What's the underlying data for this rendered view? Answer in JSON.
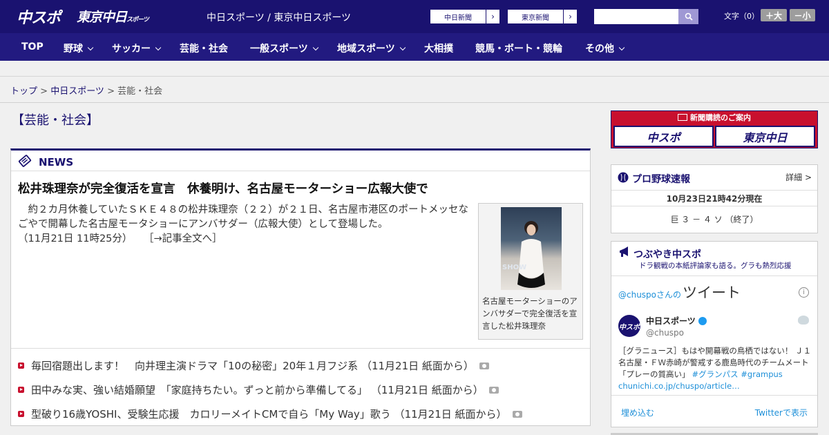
{
  "header": {
    "logo_chuspo": "中スポ",
    "logo_tokyo": "東京中日",
    "logo_tokyo_small": "スポーツ",
    "title": "中日スポーツ / 東京中日スポーツ",
    "paper1": "中日新聞",
    "paper2": "東京新聞",
    "search_placeholder": "",
    "font_label": "文字（0）",
    "font_plus": "＋大",
    "font_minus": "－小"
  },
  "nav": {
    "items": [
      "TOP",
      "野球",
      "サッカー",
      "芸能・社会",
      "一般スポーツ",
      "地域スポーツ",
      "大相撲",
      "競馬・ボート・競輪",
      "その他"
    ]
  },
  "breadcrumb": {
    "top": "トップ",
    "sep": " > ",
    "chunichi": "中日スポーツ",
    "current": "芸能・社会"
  },
  "section": {
    "title": "【芸能・社会】"
  },
  "news": {
    "label": "NEWS",
    "headline": "松井珠理奈が完全復活を宣言　休養明け、名古屋モーターショー広報大使で",
    "lead": "　約２カ月休養していたＳＫＥ４８の松井珠理奈（２２）が２１日、名古屋市港区のポートメッセなごやで開幕した名古屋モータショーにアンバサダー（広報大使）として登場した。",
    "lead_date": "（11月21日 11時25分）",
    "lead_more": "［→記事全文へ］",
    "photo_caption": "名古屋モーターショーのアンバサダーで完全復活を宣言した松井珠理奈",
    "items": [
      "毎回宿題出します！　向井理主演ドラマ「10の秘密」20年１月フジ系 （11月21日 紙面から）",
      "田中みな実、強い結婚願望　「家庭持ちたい。ずっと前から準備してる」 （11月21日 紙面から）",
      "型破り16歳YOSHI、受験生応援　カロリーメイトCMで自ら「My Way」歌う （11月21日 紙面から）"
    ]
  },
  "subscribe": {
    "head": "新聞購読のご案内",
    "btn1": "中スポ",
    "btn2": "東京中日"
  },
  "baseball": {
    "title": "プロ野球速報",
    "detail": "詳細 >",
    "time": "10月23日21時42分現在",
    "score": "巨 ３ － ４ ソ （終了）"
  },
  "twitter": {
    "title": "つぶやき中スポ",
    "subtitle": "ドラ観戦の本紙評論家も語る。グラも熱烈応援",
    "head_prefix": "@chuspoさんの",
    "head_big": "ツイート",
    "info": "i",
    "avatar_text": "中スポ",
    "name": "中日スポーツ",
    "handle": "@chuspo",
    "text": "［グラニュース］もはや開幕戦の鳥栖ではない！ Ｊ１名古屋・ＦＷ赤崎が警戒する鹿島時代のチームメート「プレーの質高い」",
    "hashtags": "#グランパス #grampus",
    "link": "chunichi.co.jp/chuspo/article…",
    "embed": "埋め込む",
    "view": "Twitterで表示"
  }
}
